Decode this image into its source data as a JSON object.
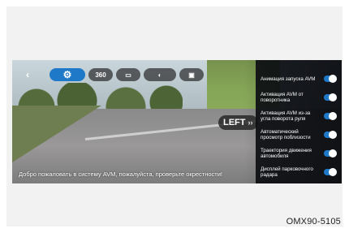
{
  "toolbar": {
    "back_icon": "chevron-left-icon",
    "gear_icon": "gear-icon",
    "view_1_label": "360",
    "view_2_icon": "car-icon",
    "view_3_icon": "car-side-icon",
    "view_4_icon": "camera-icon"
  },
  "direction_badge": {
    "label": "LEFT",
    "arrows": "››"
  },
  "message": {
    "text": "Добро пожаловать в систему AVM, пожалуйста, проверьте окрестности!"
  },
  "settings": {
    "items": [
      {
        "label": "Анимация запуска AVM",
        "on": true
      },
      {
        "label": "Активация AVM от поворотника",
        "on": true
      },
      {
        "label": "Активация AVM из-за угла поворота руля",
        "on": true
      },
      {
        "label": "Автоматический просмотр поблизости",
        "on": true
      },
      {
        "label": "Траектория движения автомобиля",
        "on": true
      },
      {
        "label": "Дисплей парковочного радара",
        "on": true
      }
    ]
  },
  "figure_code": "OMX90-5105",
  "colors": {
    "accent": "#1e79c8",
    "panel": "#0c0e12"
  }
}
